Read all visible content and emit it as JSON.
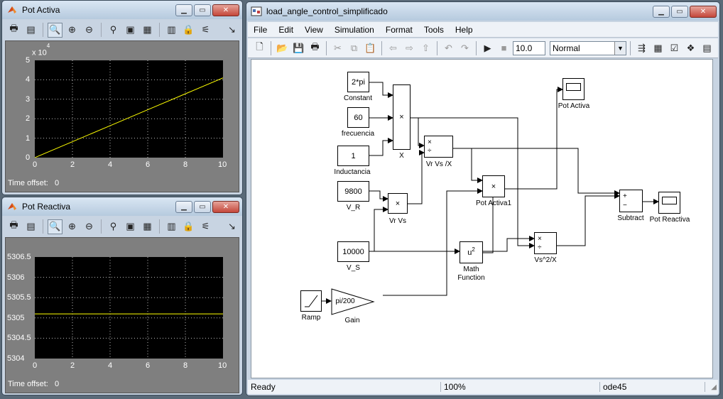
{
  "scope1": {
    "title": "Pot Activa",
    "time_offset_label": "Time offset:",
    "time_offset_value": "0",
    "exponent": "x 10",
    "exp_power": "4",
    "yticks": [
      "5",
      "4",
      "3",
      "2",
      "1",
      "0"
    ],
    "xticks": [
      "0",
      "2",
      "4",
      "6",
      "8",
      "10"
    ]
  },
  "scope2": {
    "title": "Pot Reactiva",
    "time_offset_label": "Time offset:",
    "time_offset_value": "0",
    "yticks": [
      "5306.5",
      "5306",
      "5305.5",
      "5305",
      "5304.5",
      "5304"
    ],
    "xticks": [
      "0",
      "2",
      "4",
      "6",
      "8",
      "10"
    ]
  },
  "model": {
    "title": "load_angle_control_simplificado",
    "menu": [
      "File",
      "Edit",
      "View",
      "Simulation",
      "Format",
      "Tools",
      "Help"
    ],
    "stop_time": "10.0",
    "sim_mode": "Normal",
    "status": {
      "state": "Ready",
      "zoom": "100%",
      "solver": "ode45"
    },
    "blocks": {
      "constant": {
        "value": "2*pi",
        "label": "Constant"
      },
      "frecuencia": {
        "value": "60",
        "label": "frecuencia"
      },
      "inductancia": {
        "value": "1",
        "label": "Inductancia"
      },
      "vr": {
        "value": "9800",
        "label": "V_R"
      },
      "vs": {
        "value": "10000",
        "label": "V_S"
      },
      "x": {
        "symbol": "×",
        "label": "X"
      },
      "vrvs": {
        "symbol": "×",
        "label": "Vr Vs"
      },
      "vrvsx": {
        "symbol_top": "×",
        "symbol_bot": "÷",
        "label": "Vr Vs /X"
      },
      "potactiva1": {
        "symbol": "×",
        "label": "Pot Activa1"
      },
      "math": {
        "symbol": "u",
        "sup": "2",
        "label1": "Math",
        "label2": "Function"
      },
      "vs2x": {
        "symbol_top": "×",
        "symbol_bot": "÷",
        "label": "Vs^2/X"
      },
      "subtract": {
        "plus": "+",
        "minus": "−",
        "label": "Subtract"
      },
      "potactiva": {
        "label": "Pot Activa"
      },
      "potreactiva": {
        "label": "Pot Reactiva"
      },
      "ramp": {
        "label": "Ramp"
      },
      "gain": {
        "value": "pi/200",
        "label": "Gain"
      }
    }
  },
  "chart_data": [
    {
      "type": "line",
      "title": "Pot Activa",
      "xlim": [
        0,
        10
      ],
      "ylim": [
        0,
        50000
      ],
      "y_exponent_label": "x 10^4",
      "grid": true,
      "series": [
        {
          "color": "#ffff00",
          "x": [
            0,
            2,
            4,
            6,
            8,
            10
          ],
          "y": [
            0,
            8200,
            16400,
            24600,
            32800,
            41000
          ]
        }
      ]
    },
    {
      "type": "line",
      "title": "Pot Reactiva",
      "xlim": [
        0,
        10
      ],
      "ylim": [
        5304,
        5306.5
      ],
      "grid": true,
      "series": [
        {
          "color": "#ffff00",
          "x": [
            0,
            10
          ],
          "y": [
            5305.1,
            5305.1
          ]
        }
      ]
    }
  ]
}
